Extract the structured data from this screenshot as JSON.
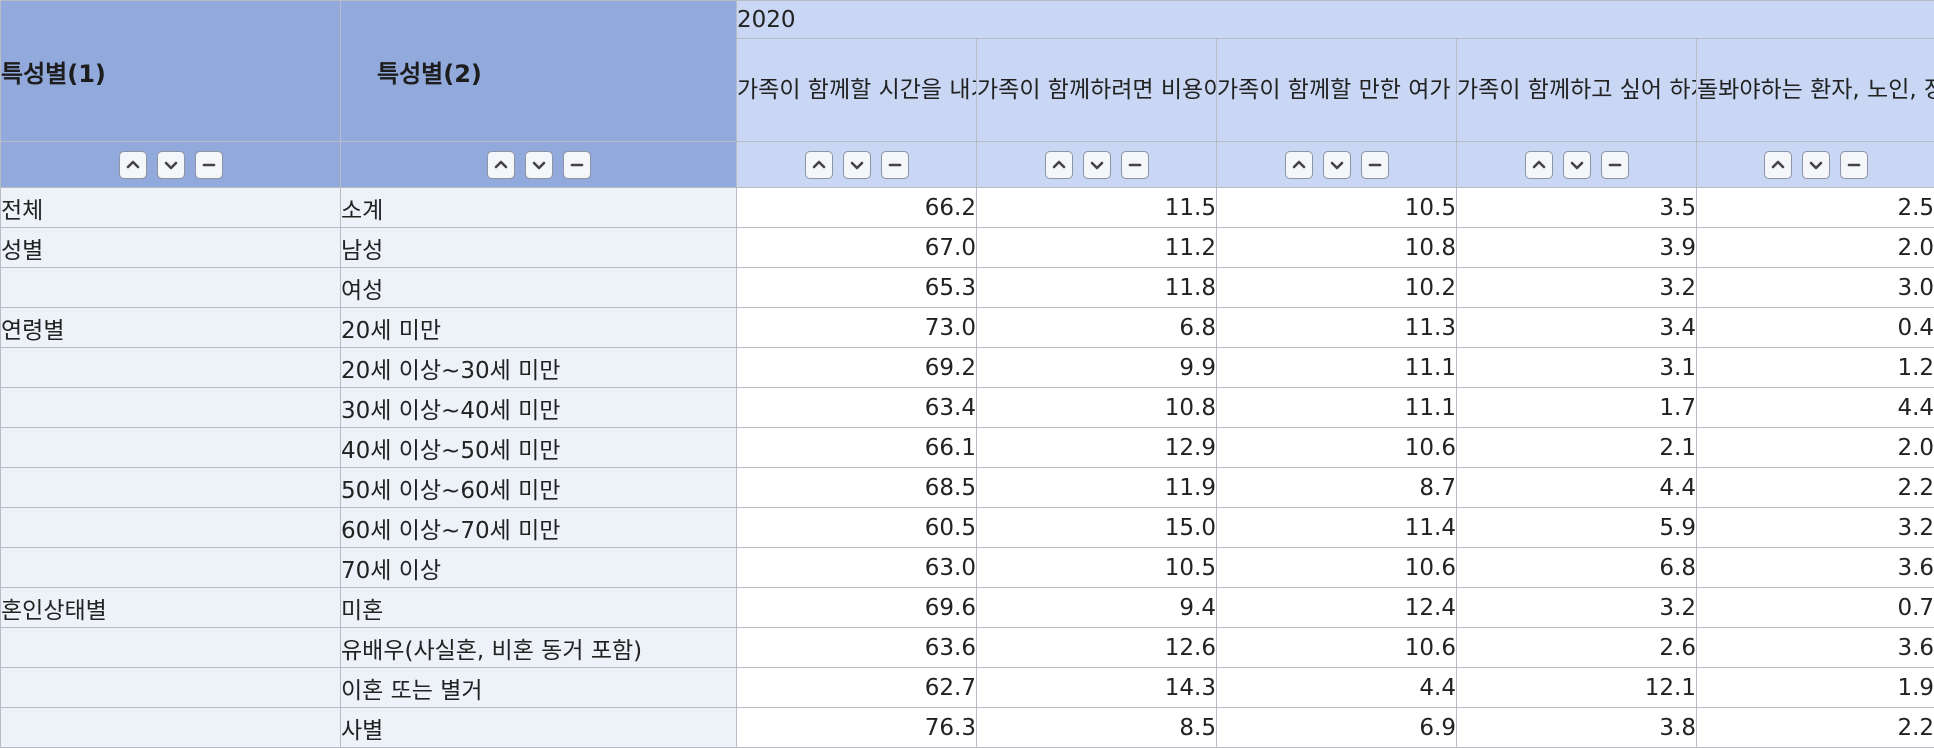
{
  "header": {
    "dim1_label": "특성별(1)",
    "dim2_label": "특성별(2)",
    "year": "2020",
    "columns": [
      "가족이 함께할 시간을 내기가 힘들어서",
      "가족이 함께하려면 비용이 들어서",
      "가족이 함께할 만한 여가 프로그램이 없어서",
      "가족이 함께하고 싶어 하지 않아서",
      "돌봐야하는 환자, 노인, 장애인, 어린 자녀 등이 있어서"
    ]
  },
  "controls": [
    "sort-up-icon",
    "sort-down-icon",
    "collapse-icon"
  ],
  "rows": [
    {
      "cat1": "전체",
      "cat2": "소계",
      "values": [
        "66.2",
        "11.5",
        "10.5",
        "3.5",
        "2.5"
      ]
    },
    {
      "cat1": "성별",
      "cat2": "남성",
      "values": [
        "67.0",
        "11.2",
        "10.8",
        "3.9",
        "2.0"
      ]
    },
    {
      "cat1": "",
      "cat2": "여성",
      "values": [
        "65.3",
        "11.8",
        "10.2",
        "3.2",
        "3.0"
      ]
    },
    {
      "cat1": "연령별",
      "cat2": "20세 미만",
      "values": [
        "73.0",
        "6.8",
        "11.3",
        "3.4",
        "0.4"
      ]
    },
    {
      "cat1": "",
      "cat2": "20세 이상~30세 미만",
      "values": [
        "69.2",
        "9.9",
        "11.1",
        "3.1",
        "1.2"
      ]
    },
    {
      "cat1": "",
      "cat2": "30세 이상~40세 미만",
      "values": [
        "63.4",
        "10.8",
        "11.1",
        "1.7",
        "4.4"
      ]
    },
    {
      "cat1": "",
      "cat2": "40세 이상~50세 미만",
      "values": [
        "66.1",
        "12.9",
        "10.6",
        "2.1",
        "2.0"
      ]
    },
    {
      "cat1": "",
      "cat2": "50세 이상~60세 미만",
      "values": [
        "68.5",
        "11.9",
        "8.7",
        "4.4",
        "2.2"
      ]
    },
    {
      "cat1": "",
      "cat2": "60세 이상~70세 미만",
      "values": [
        "60.5",
        "15.0",
        "11.4",
        "5.9",
        "3.2"
      ]
    },
    {
      "cat1": "",
      "cat2": "70세 이상",
      "values": [
        "63.0",
        "10.5",
        "10.6",
        "6.8",
        "3.6"
      ]
    },
    {
      "cat1": "혼인상태별",
      "cat2": "미혼",
      "values": [
        "69.6",
        "9.4",
        "12.4",
        "3.2",
        "0.7"
      ]
    },
    {
      "cat1": "",
      "cat2": "유배우(사실혼, 비혼 동거 포함)",
      "values": [
        "63.6",
        "12.6",
        "10.6",
        "2.6",
        "3.6"
      ]
    },
    {
      "cat1": "",
      "cat2": "이혼 또는 별거",
      "values": [
        "62.7",
        "14.3",
        "4.4",
        "12.1",
        "1.9"
      ]
    },
    {
      "cat1": "",
      "cat2": "사별",
      "values": [
        "76.3",
        "8.5",
        "6.9",
        "3.8",
        "2.2"
      ]
    }
  ]
}
